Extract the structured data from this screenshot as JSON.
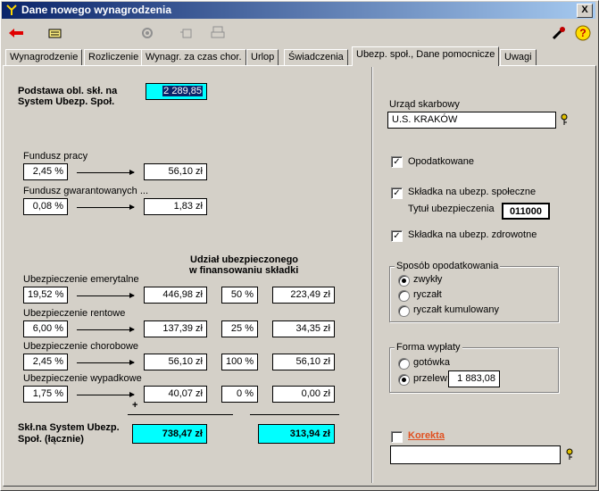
{
  "window": {
    "title": "Dane nowego wynagrodzenia",
    "close": "X"
  },
  "tabs": [
    "Wynagrodzenie",
    "Rozliczenie",
    "Wynagr. za czas chor.",
    "Urlop",
    "Świadczenia",
    "Ubezp. społ., Dane pomocnicze",
    "Uwagi"
  ],
  "left": {
    "podstawa_label_1": "Podstawa obl. skł. na",
    "podstawa_label_2": "System Ubezp. Społ.",
    "podstawa_value": "2 289,85",
    "fundusz_pracy": {
      "label": "Fundusz pracy",
      "rate": "2,45 %",
      "amount": "56,10 zł"
    },
    "fgsp": {
      "label": "Fundusz gwarantowanych ...",
      "rate": "0,08 %",
      "amount": "1,83 zł"
    },
    "udzial_header_1": "Udział ubezpieczonego",
    "udzial_header_2": "w finansowaniu składki",
    "rows": [
      {
        "label": "Ubezpieczenie emerytalne",
        "rate": "19,52 %",
        "amount": "446,98 zł",
        "share": "50 %",
        "insured": "223,49 zł"
      },
      {
        "label": "Ubezpieczenie rentowe",
        "rate": "6,00 %",
        "amount": "137,39 zł",
        "share": "25 %",
        "insured": "34,35 zł"
      },
      {
        "label": "Ubezpieczenie chorobowe",
        "rate": "2,45 %",
        "amount": "56,10 zł",
        "share": "100 %",
        "insured": "56,10 zł"
      },
      {
        "label": "Ubezpieczenie wypadkowe",
        "rate": "1,75 %",
        "amount": "40,07 zł",
        "share": "0 %",
        "insured": "0,00 zł"
      }
    ],
    "plus": "+",
    "total_label_1": "Skł.na System Ubezp.",
    "total_label_2": "Społ. (łącznie)",
    "total_value": "738,47 zł",
    "total_insured": "313,94 zł"
  },
  "right": {
    "urzad_label": "Urząd skarbowy",
    "urzad_value": "U.S. KRAKÓW",
    "opodatkowane": "Opodatkowane",
    "skladka_spol": "Składka na ubezp. społeczne",
    "tytul_label": "Tytuł ubezpieczenia",
    "tytul_value": "011000",
    "skladka_zdrow": "Składka na  ubezp. zdrowotne",
    "sposob_label": "Sposób opodatkowania",
    "sposob_options": [
      "zwykły",
      "ryczałt",
      "ryczałt kumulowany"
    ],
    "forma_label": "Forma wypłaty",
    "forma_options": [
      "gotówka",
      "przelew"
    ],
    "przelew_value": "1 883,08",
    "korekta": "Korekta",
    "korekta_value": ""
  },
  "colors": {
    "cyan": "#00ffff",
    "korekta": "#e05020",
    "title_start": "#0a246a"
  },
  "icons": [
    "back-arrow-icon",
    "edit-icon",
    "calculator-icon",
    "copy-icon",
    "print-icon",
    "tools-icon",
    "help-icon"
  ]
}
